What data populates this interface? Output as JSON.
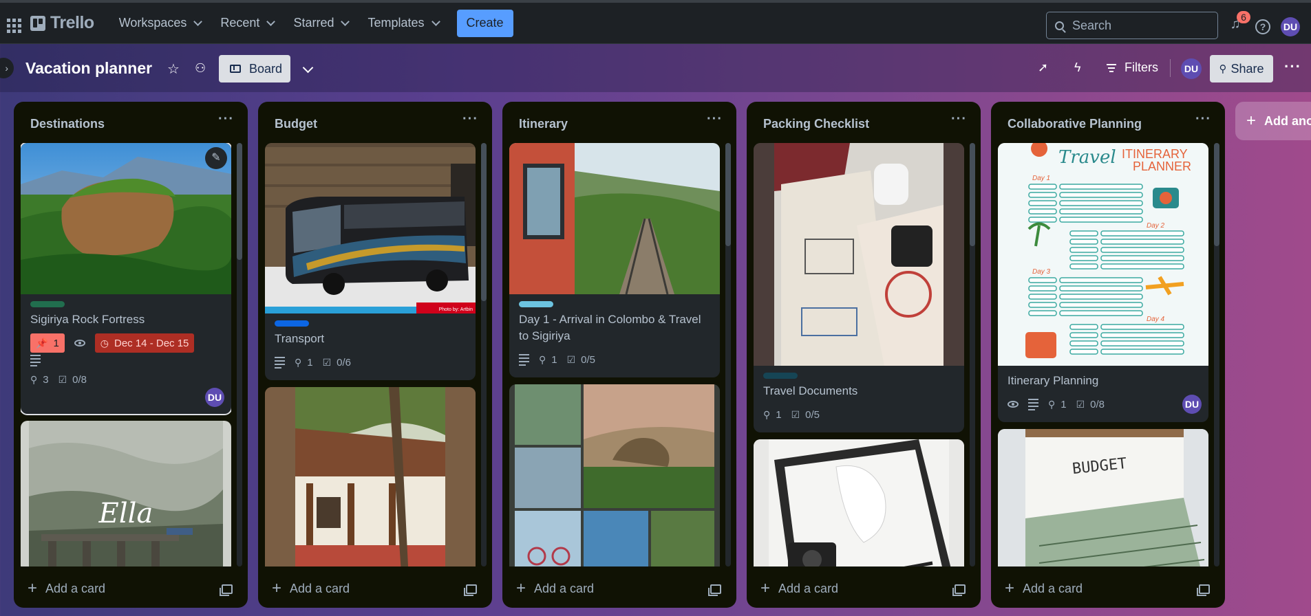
{
  "nav": {
    "logo": "Trello",
    "menus": [
      "Workspaces",
      "Recent",
      "Starred",
      "Templates"
    ],
    "create_label": "Create",
    "search_placeholder": "Search",
    "notifications_count": "6",
    "user_initials": "DU"
  },
  "board": {
    "title": "Vacation planner",
    "view_label": "Board",
    "filters_label": "Filters",
    "share_label": "Share",
    "member_initials": "DU",
    "add_list_label": "Add another list"
  },
  "lists": [
    {
      "title": "Destinations",
      "add_card_label": "Add a card",
      "cards": [
        {
          "title": "Sigiriya Rock Fortress",
          "label_color": "#216e4e",
          "pin_count": "1",
          "date": "Dec 14 - Dec 15",
          "attachments": "3",
          "checklist": "0/8",
          "member": "DU",
          "cover": "sigiriya-rock-photo"
        },
        {
          "title": "Ella",
          "cover": "ella-misty-bridge-photo",
          "cover_text": "Ella"
        }
      ]
    },
    {
      "title": "Budget",
      "add_card_label": "Add a card",
      "cards": [
        {
          "title": "Transport",
          "label_color": "#0c66e4",
          "attachments": "1",
          "checklist": "0/6",
          "cover": "coach-bus-photo",
          "photo_credit": "Photo by: Artbin"
        },
        {
          "title": "",
          "cover": "colonial-bungalow-photo"
        }
      ]
    },
    {
      "title": "Itinerary",
      "add_card_label": "Add a card",
      "cards": [
        {
          "title": "Day 1 - Arrival in Colombo & Travel to Sigiriya",
          "label_color": "#6cc3e0",
          "attachments": "1",
          "checklist": "0/5",
          "cover": "train-railway-photo"
        },
        {
          "title": "",
          "cover": "sri-lanka-collage-photo"
        }
      ]
    },
    {
      "title": "Packing Checklist",
      "add_card_label": "Add a card",
      "cards": [
        {
          "title": "Travel Documents",
          "label_color": "#164555",
          "attachments": "1",
          "checklist": "0/5",
          "cover": "passport-photo"
        },
        {
          "title": "",
          "cover": "suitcase-packing-photo"
        }
      ]
    },
    {
      "title": "Collaborative Planning",
      "add_card_label": "Add a card",
      "cards": [
        {
          "title": "Itinerary Planning",
          "attachments": "1",
          "checklist": "0/8",
          "member": "DU",
          "cover": "travel-itinerary-planner-graphic",
          "cover_title_1": "Travel",
          "cover_title_2": "ITINERARY",
          "cover_title_3": "PLANNER",
          "cover_days": [
            "Day 1",
            "Day 2",
            "Day 3",
            "Day 4"
          ]
        },
        {
          "title": "",
          "cover": "budget-money-photo",
          "cover_text": "BUDGET"
        }
      ]
    }
  ]
}
